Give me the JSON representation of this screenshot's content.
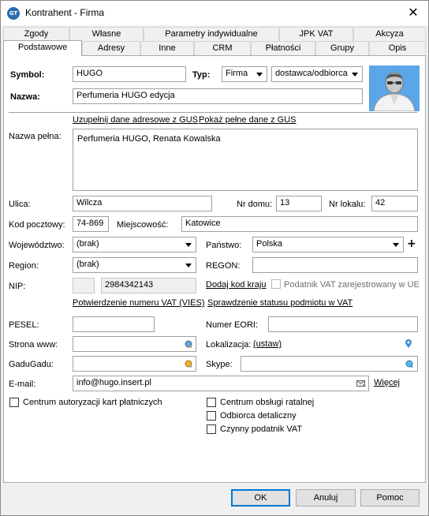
{
  "window": {
    "title": "Kontrahent - Firma",
    "app_icon_text": "GT",
    "close_glyph": "✕"
  },
  "tabs_row1": [
    "Zgody",
    "Własne",
    "Parametry indywidualne",
    "JPK VAT",
    "Akcyza"
  ],
  "tabs_row2": [
    "Podstawowe",
    "Adresy",
    "Inne",
    "CRM",
    "Płatności",
    "Grupy",
    "Opis"
  ],
  "form": {
    "symbol_label": "Symbol:",
    "symbol_value": "HUGO",
    "typ_label": "Typ:",
    "typ_value": "Firma",
    "typ2_value": "dostawca/odbiorca",
    "nazwa_label": "Nazwa:",
    "nazwa_value": "Perfumeria HUGO edycja",
    "gus_link": "Uzupełnij dane adresowe z GUS",
    "gus_full_link": "Pokaż pełne dane z GUS",
    "nazwa_pelna_label": "Nazwa pełna:",
    "nazwa_pelna_value": "Perfumeria HUGO, Renata Kowalska",
    "ulica_label": "Ulica:",
    "ulica_value": "Wilcza",
    "nr_domu_label": "Nr domu:",
    "nr_domu_value": "13",
    "nr_lokalu_label": "Nr lokalu:",
    "nr_lokalu_value": "42",
    "kod_label": "Kod pocztowy:",
    "kod_value": "74-869",
    "miejscowosc_label": "Miejscowość:",
    "miejscowosc_value": "Katowice",
    "wojewodztwo_label": "Województwo:",
    "wojewodztwo_value": "(brak)",
    "panstwo_label": "Państwo:",
    "panstwo_value": "Polska",
    "panstwo_add": "+",
    "region_label": "Region:",
    "region_value": "(brak)",
    "regon_label": "REGON:",
    "regon_value": "",
    "nip_label": "NIP:",
    "nip_prefix_value": "",
    "nip_value": "2984342143",
    "dodaj_kod_link": "Dodaj kod kraju",
    "vat_ue_label": "Podatnik VAT zarejestrowany w UE",
    "vies_link": "Potwierdzenie numeru VAT (VIES)",
    "status_vat_link": "Sprawdzenie statusu podmiotu w VAT",
    "pesel_label": "PESEL:",
    "pesel_value": "",
    "eori_label": "Numer EORI:",
    "eori_value": "",
    "www_label": "Strona www:",
    "www_value": "",
    "lokalizacja_label": "Lokalizacja:",
    "lokalizacja_link": "(ustaw)",
    "gadu_label": "GaduGadu:",
    "gadu_value": "",
    "skype_label": "Skype:",
    "skype_value": "",
    "email_label": "E-mail:",
    "email_value": "info@hugo.insert.pl",
    "wiecej_link": "Więcej",
    "chk_centrum_kart": "Centrum autoryzacji kart płatniczych",
    "chk_ratalna": "Centrum obsługi ratalnej",
    "chk_detaliczny": "Odbiorca detaliczny",
    "chk_czynny_vat": "Czynny podatnik VAT"
  },
  "buttons": {
    "ok": "OK",
    "cancel": "Anuluj",
    "help": "Pomoc"
  },
  "colors": {
    "accent": "#0078d7",
    "avatar_bg": "#5aa6e6",
    "link_disabled": "#6d6d6d"
  }
}
